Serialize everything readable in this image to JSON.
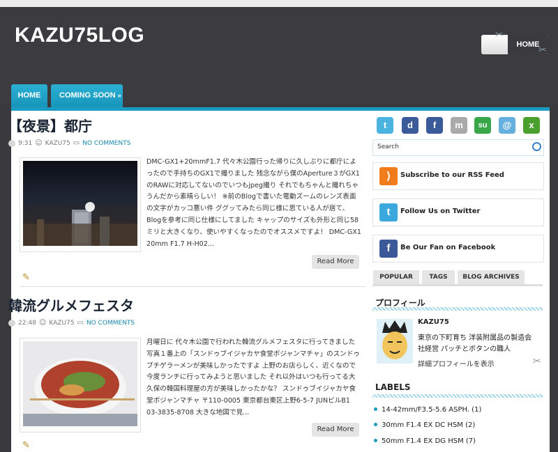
{
  "site": {
    "title": "KAZU75LOG"
  },
  "header": {
    "home_button": "HOME"
  },
  "nav": {
    "tabs": [
      {
        "label": "HOME"
      },
      {
        "label": "COMING SOON",
        "arrow": "»"
      }
    ]
  },
  "posts": [
    {
      "title": "【夜景】都庁",
      "time": "9:31",
      "author": "KAZU75",
      "comments": "NO COMMENTS",
      "excerpt": "DMC-GX1+20mmF1.7 代々木公園行った帰りに久しぶりに都庁によったので手持ちのGX1で撮りました 残念ながら僕のAperture３がGX1のRAWに対応してないのでいつもjpeg撮り それでもちゃんと撮れちゃうんだから素晴らしい！ ※前のBlogで書いた電動ズームのレンズ表面の文字がカッコ悪い件 ググッてみたら同じ様に思ている人が居て、Blogを参考に同じ仕様にしてました キャップのサイズも外形と同じ58ミリと大きくなり、使いやすくなったのでオススメですよ！ DMC-GX1 20mm F1.7 H-H02...",
      "read_more": "Read More"
    },
    {
      "title": "韓流グルメフェスタ",
      "time": "22:48",
      "author": "KAZU75",
      "comments": "NO COMMENTS",
      "excerpt": "月曜日に 代々木公園で行われた韓流グルメフェスタに行ってきました 写真１番上の「スンドゥブイジャカヤ食堂ポジャンマチャ」のスンドゥブチゲラーメンが美味しかったですよ 上野のお店らしく、近くなので今度ランチに行ってみようと思いました それ以外はいつも行ってる大久保の韓国料理屋の方が美味しかったかな？ スンドゥブイジャカヤ食堂ポジャンマチャ 〒110-0005 東京都台東区上野6-5-7 JUNビルB1 03-3835-8708 大きな地図で見...",
      "read_more": "Read More"
    }
  ],
  "sidebar": {
    "social_icons": [
      {
        "icon": "twitter-bird-icon",
        "glyph": "t",
        "color": "#4bb3e0"
      },
      {
        "icon": "delicious-icon",
        "glyph": "d",
        "color": "#3b5a9a"
      },
      {
        "icon": "facebook-icon",
        "glyph": "f",
        "color": "#3b5a9a"
      },
      {
        "icon": "myspace-icon",
        "glyph": "m",
        "color": "#aaaaaa"
      },
      {
        "icon": "stumbleupon-icon",
        "glyph": "su",
        "color": "#3aa64a"
      },
      {
        "icon": "mail-icon",
        "glyph": "@",
        "color": "#66b0e0"
      },
      {
        "icon": "xing-icon",
        "glyph": "x",
        "color": "#4aa02c"
      }
    ],
    "search": {
      "placeholder": "Search"
    },
    "widgets": [
      {
        "label": "Subscribe to our RSS Feed",
        "icon": "rss-icon",
        "glyph": ")",
        "color": "#f27c1c"
      },
      {
        "label": "Follow Us on Twitter",
        "icon": "twitter-icon",
        "glyph": "t",
        "color": "#3aa8dc"
      },
      {
        "label": "Be Our Fan on Facebook",
        "icon": "facebook-icon",
        "glyph": "f",
        "color": "#3b5998"
      }
    ],
    "tabs": [
      {
        "label": "POPULAR"
      },
      {
        "label": "TAGS"
      },
      {
        "label": "BLOG ARCHIVES"
      }
    ],
    "profile": {
      "heading": "プロフィール",
      "name": "KAZU75",
      "bio_line1": "東京の下町育ち 洋装附属品の製造会",
      "bio_line2": "社経営 パッチとボタンの職人",
      "view_link": "詳細プロフィールを表示"
    },
    "labels": {
      "heading": "LABELS",
      "items": [
        {
          "text": "14-42mm/F3.5-5.6 ASPH. (1)"
        },
        {
          "text": "30mm F1.4 EX DC HSM (2)"
        },
        {
          "text": "50mm F1.4 EX DG HSM (7)"
        }
      ]
    }
  }
}
